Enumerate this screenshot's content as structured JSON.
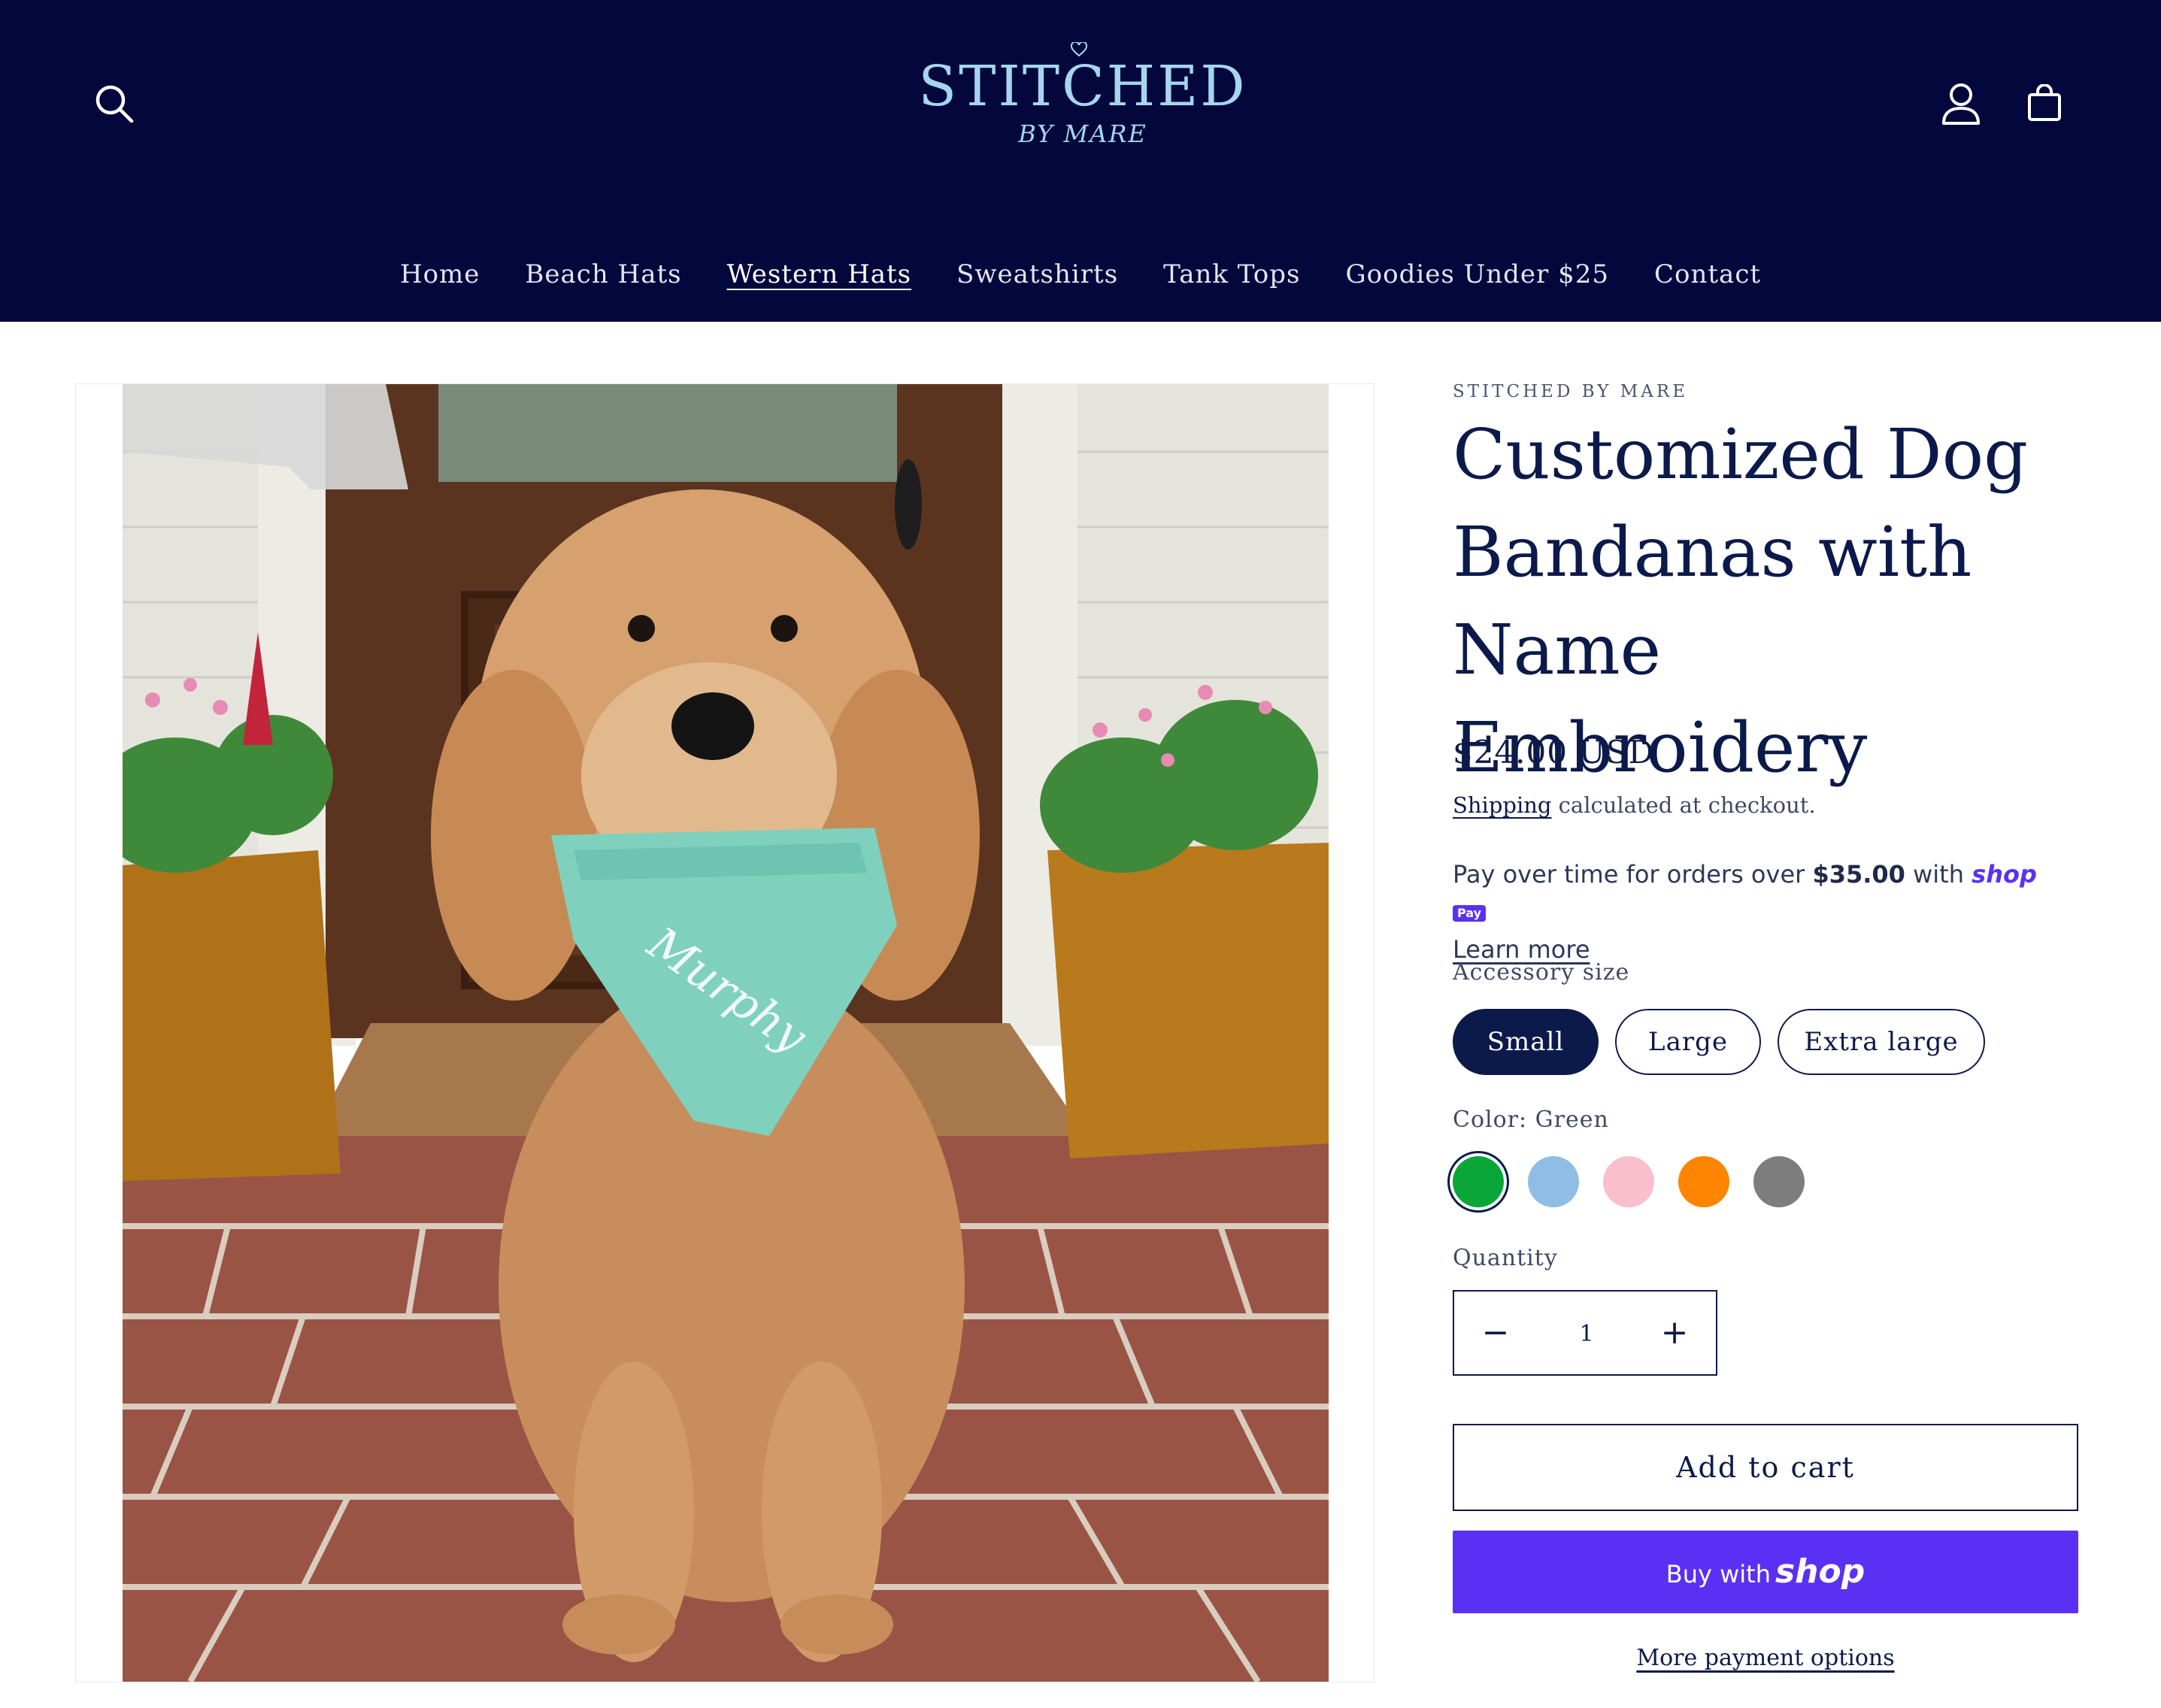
{
  "header": {
    "logo_main": "STITCHED",
    "logo_sub": "BY MARE",
    "icons": {
      "search": "search-icon",
      "account": "account-icon",
      "cart": "cart-icon"
    }
  },
  "nav": {
    "items": [
      "Home",
      "Beach Hats",
      "Western Hats",
      "Sweatshirts",
      "Tank Tops",
      "Goodies Under $25",
      "Contact"
    ],
    "active": "Western Hats"
  },
  "product": {
    "vendor": "STITCHED BY MARE",
    "title": "Customized Dog Bandanas with Name Embroidery",
    "price": "$24.00 USD",
    "shipping_link": "Shipping",
    "shipping_rest": " calculated at checkout.",
    "image_name_text": "Murphy",
    "shoppay": {
      "prefix": "Pay over time for orders over ",
      "amount": "$35.00",
      "suffix": " with ",
      "brand": "shop",
      "badge": "Pay",
      "learn_more": "Learn more"
    },
    "size": {
      "label": "Accessory size",
      "options": [
        "Small",
        "Large",
        "Extra large"
      ],
      "selected": "Small"
    },
    "color": {
      "label": "Color: Green",
      "swatches": [
        {
          "name": "Green",
          "hex": "#0aa63a"
        },
        {
          "name": "Light blue",
          "hex": "#8fbde6"
        },
        {
          "name": "Pink",
          "hex": "#f9bfcc"
        },
        {
          "name": "Orange",
          "hex": "#ff8500"
        },
        {
          "name": "Gray",
          "hex": "#7d7d7d"
        }
      ],
      "selected": "Green"
    },
    "quantity": {
      "label": "Quantity",
      "value": "1",
      "minus": "−",
      "plus": "+"
    },
    "add_to_cart": "Add to cart",
    "buy_with": "Buy with",
    "buy_brand": "shop",
    "more_payment": "More payment options"
  },
  "colors": {
    "header_bg": "#04073c",
    "logo": "#a6d6ee",
    "text": "#0b1a4a",
    "shop_purple": "#5a31f4"
  }
}
